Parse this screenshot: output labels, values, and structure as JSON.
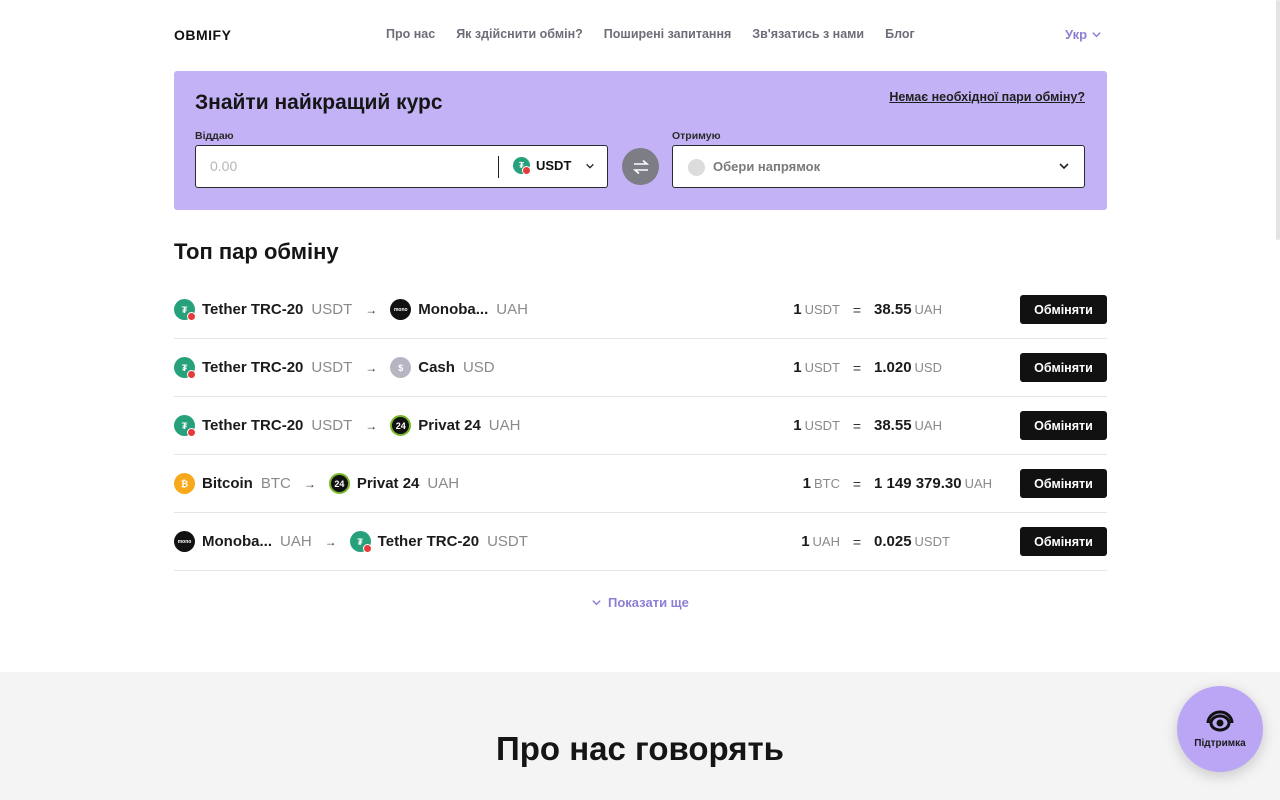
{
  "header": {
    "logo": "OBMIFY",
    "nav": [
      "Про нас",
      "Як здійснити обмін?",
      "Поширені запитання",
      "Зв'язатись з нами",
      "Блог"
    ],
    "language": "Укр"
  },
  "exchange_panel": {
    "title": "Знайти найкращий курс",
    "missing_pair_link": "Немає необхідної пари обміну?",
    "give_label": "Віддаю",
    "give_placeholder": "0.00",
    "give_currency": "USDT",
    "get_label": "Отримую",
    "get_placeholder": "Обери напрямок",
    "colors": {
      "panel_bg": "#c3b3f6",
      "accent": "#8b7fd4"
    }
  },
  "top_pairs": {
    "title": "Топ пар обміну",
    "button_label": "Обміняти",
    "rows": [
      {
        "from_name": "Tether TRC-20",
        "from_code": "USDT",
        "from_icon": "tether",
        "to_name": "Monoba...",
        "to_code": "UAH",
        "to_icon": "mono",
        "left_amount": "1",
        "left_code": "USDT",
        "eq": "=",
        "right_amount": "38.55",
        "right_code": "UAH"
      },
      {
        "from_name": "Tether TRC-20",
        "from_code": "USDT",
        "from_icon": "tether",
        "to_name": "Cash",
        "to_code": "USD",
        "to_icon": "cash",
        "left_amount": "1",
        "left_code": "USDT",
        "eq": "=",
        "right_amount": "1.020",
        "right_code": "USD"
      },
      {
        "from_name": "Tether TRC-20",
        "from_code": "USDT",
        "from_icon": "tether",
        "to_name": "Privat 24",
        "to_code": "UAH",
        "to_icon": "privat",
        "left_amount": "1",
        "left_code": "USDT",
        "eq": "=",
        "right_amount": "38.55",
        "right_code": "UAH"
      },
      {
        "from_name": "Bitcoin",
        "from_code": "BTC",
        "from_icon": "btc",
        "to_name": "Privat 24",
        "to_code": "UAH",
        "to_icon": "privat",
        "left_amount": "1",
        "left_code": "BTC",
        "eq": "=",
        "right_amount": "1 149 379.30",
        "right_code": "UAH"
      },
      {
        "from_name": "Monoba...",
        "from_code": "UAH",
        "from_icon": "mono",
        "to_name": "Tether TRC-20",
        "to_code": "USDT",
        "to_icon": "tether",
        "left_amount": "1",
        "left_code": "UAH",
        "eq": "=",
        "right_amount": "0.025",
        "right_code": "USDT"
      }
    ],
    "show_more": "Показати ще"
  },
  "reviews": {
    "title": "Про нас говорять"
  },
  "support": {
    "label": "Підтримка"
  }
}
